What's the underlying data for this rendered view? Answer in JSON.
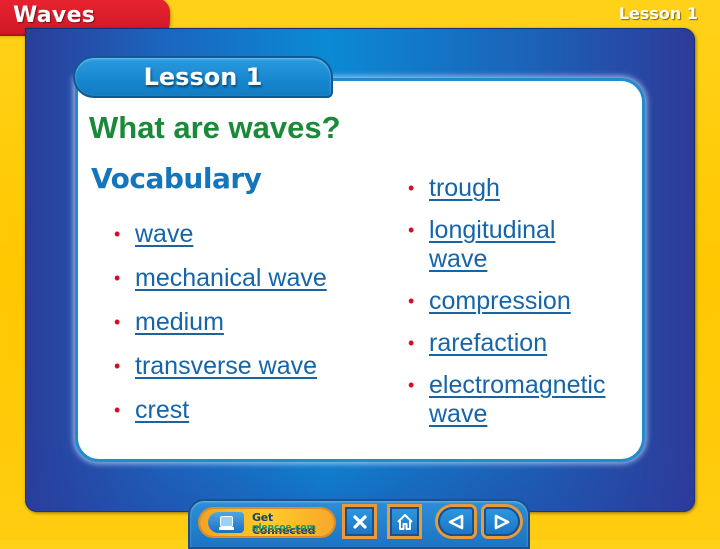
{
  "header": {
    "chapter_title": "Waves",
    "lesson_corner_label": "Lesson 1"
  },
  "lesson_tab": {
    "label": "Lesson 1"
  },
  "main": {
    "title": "What are waves?",
    "section_heading": "Vocabulary",
    "vocab_left": [
      {
        "term": "wave"
      },
      {
        "term": "mechanical wave"
      },
      {
        "term": "medium"
      },
      {
        "term": "transverse wave"
      },
      {
        "term": "crest"
      }
    ],
    "vocab_right": [
      {
        "term": "trough"
      },
      {
        "term": "longitudinal wave"
      },
      {
        "term": "compression"
      },
      {
        "term": "rarefaction"
      },
      {
        "term": "electromagnetic wave"
      }
    ],
    "bullet": "•"
  },
  "navbar": {
    "get_connected": {
      "label": "Get Connected",
      "link_text": "glencoe.com",
      "icon": "computer-monitor-icon"
    },
    "buttons": [
      {
        "name": "close",
        "icon": "close-x-icon"
      },
      {
        "name": "home",
        "icon": "home-icon"
      },
      {
        "name": "previous",
        "icon": "arrow-left-icon"
      },
      {
        "name": "next",
        "icon": "arrow-right-icon"
      }
    ]
  },
  "colors": {
    "background_yellow": "#ffc800",
    "chapter_tab_red": "#d01826",
    "frame_blue": "#1c64bd",
    "title_green": "#1a8a3a",
    "heading_blue": "#1475bd",
    "link_blue": "#1565a8",
    "bullet_red": "#d0102a"
  }
}
